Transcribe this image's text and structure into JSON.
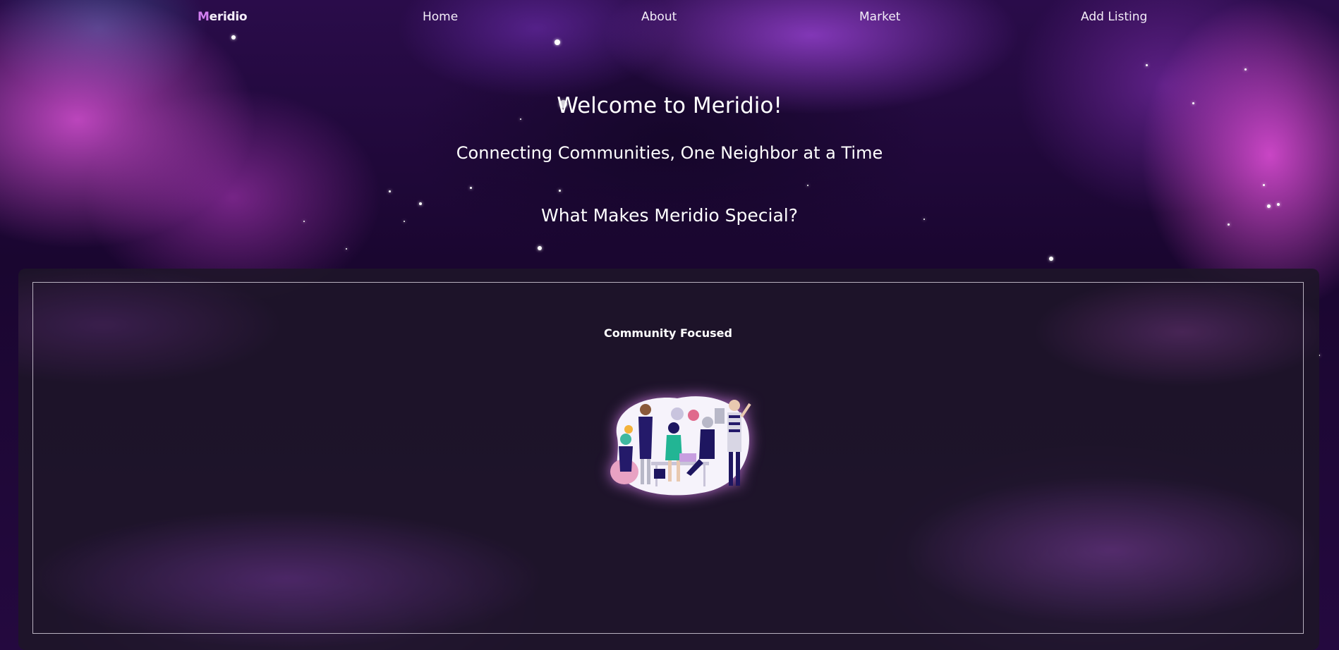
{
  "nav": {
    "brand_first": "M",
    "brand_rest": "eridio",
    "items": [
      {
        "label": "Home"
      },
      {
        "label": "About"
      },
      {
        "label": "Market"
      },
      {
        "label": "Add Listing"
      }
    ]
  },
  "hero": {
    "title": "Welcome to Meridio!",
    "subtitle": "Connecting Communities, One Neighbor at a Time",
    "section_heading": "What Makes Meridio Special?"
  },
  "features": [
    {
      "title": "Community Focused",
      "illustration": "team-collaboration-illustration"
    }
  ],
  "colors": {
    "brand_accent": "#d27ef0",
    "panel_border": "#b8b0bf",
    "text": "#ffffff"
  }
}
